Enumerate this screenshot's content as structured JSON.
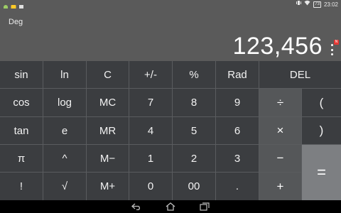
{
  "status_bar": {
    "time": "23:02",
    "battery": "73",
    "left_icons": [
      "android-icon",
      "notification-icon",
      "sd-card-icon"
    ],
    "right_icons": [
      "vibrate-icon",
      "wifi-icon",
      "battery-icon"
    ]
  },
  "display": {
    "mode": "Deg",
    "result": "123,456",
    "notification_badge": "N"
  },
  "keys": {
    "row1": [
      "sin",
      "ln",
      "C",
      "+/-",
      "%",
      "Rad",
      "DEL"
    ],
    "row2": [
      "cos",
      "log",
      "MC",
      "7",
      "8",
      "9",
      "÷",
      "("
    ],
    "row3": [
      "tan",
      "e",
      "MR",
      "4",
      "5",
      "6",
      "×",
      ")"
    ],
    "row4": [
      "π",
      "^",
      "M−",
      "1",
      "2",
      "3",
      "−"
    ],
    "row5": [
      "!",
      "√",
      "M+",
      "0",
      "00",
      ".",
      "+"
    ],
    "equals": "="
  },
  "colors": {
    "display_bg": "#5a5a5a",
    "keypad_bg": "#3b3d40",
    "operator_bg": "#555759",
    "equals_bg": "#7d7f82"
  },
  "nav_bar": [
    "back-icon",
    "home-icon",
    "recent-apps-icon"
  ]
}
